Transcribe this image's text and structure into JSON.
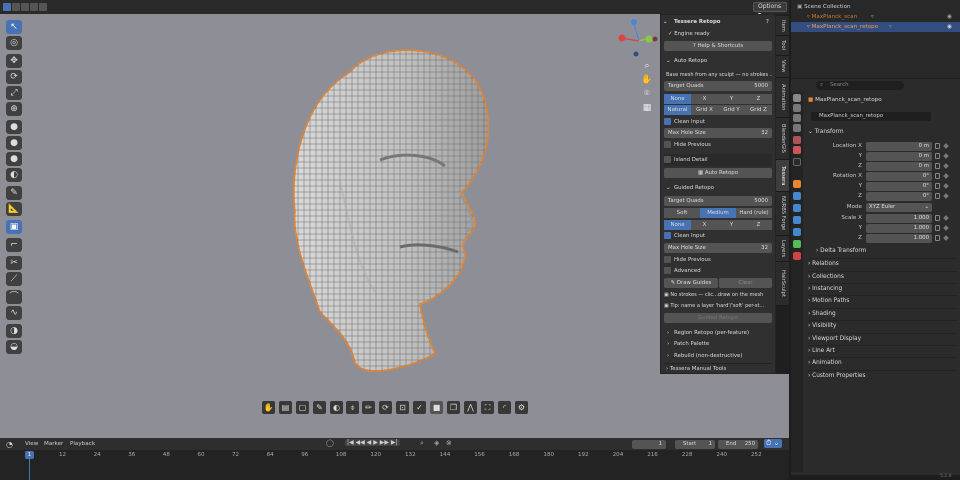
{
  "topbar": {
    "options_label": "Options"
  },
  "tessera": {
    "panel_title": "Tessera Retopo",
    "engine_status": "Engine ready",
    "help_label": "Help & Shortcuts",
    "auto": {
      "title": "Auto Retopo",
      "desc": "Base mesh from any sculpt — no strokes ...",
      "target_label": "Target Quads",
      "target_value": "5000",
      "sym": [
        "None",
        "X",
        "Y",
        "Z"
      ],
      "grid": [
        "Natural",
        "Grid X",
        "Grid Y",
        "Grid Z"
      ],
      "clean_input": "Clean Input",
      "max_hole_label": "Max Hole Size",
      "max_hole_value": "32",
      "hide_prev": "Hide Previous",
      "island": "Island Detail",
      "run": "Auto Retopo"
    },
    "guided": {
      "title": "Guided Retopo",
      "target_label": "Target Quads",
      "target_value": "5000",
      "density": [
        "Soft",
        "Medium",
        "Hard (rule)"
      ],
      "sym": [
        "None",
        "X",
        "Y",
        "Z"
      ],
      "clean_input": "Clean Input",
      "max_hole_label": "Max Hole Size",
      "max_hole_value": "32",
      "hide_prev": "Hide Previous",
      "advanced": "Advanced",
      "draw_guides": "Draw Guides",
      "clear": "Clear",
      "no_strokes": "No strokes — clic...draw on the mesh",
      "tip": "Tip: name a layer 'hard'/'soft' per-st...",
      "run": "Guided Retopo"
    },
    "subs": [
      "Region Retopo (per-feature)",
      "Patch Palette",
      "Rebuild (non-destructive)"
    ],
    "manual": "Tessera Manual Tools"
  },
  "ntabs": [
    "Item",
    "Tool",
    "View",
    "Animation",
    "BlenderGIS",
    "Tessera",
    "NURBS Forge",
    "Layers",
    "HairSculpt"
  ],
  "outliner": {
    "root": "Scene Collection",
    "items": [
      "MaxPlanck_scan",
      "MaxPlanck_scan_retopo"
    ]
  },
  "props": {
    "search_placeholder": "Search",
    "object_name": "MaxPlanck_scan_retopo",
    "object_name_field": "MaxPlanck_scan_retopo",
    "transform": "Transform",
    "location_label": "Location X",
    "y": "Y",
    "z": "Z",
    "location": [
      "0 m",
      "0 m",
      "0 m"
    ],
    "rotation_label": "Rotation X",
    "rotation": [
      "0°",
      "0°",
      "0°"
    ],
    "mode_label": "Mode",
    "mode": "XYZ Euler",
    "scale_label": "Scale X",
    "scale": [
      "1.000",
      "1.000",
      "1.000"
    ],
    "delta": "Delta Transform",
    "sections": [
      "Relations",
      "Collections",
      "Instancing",
      "Motion Paths",
      "Shading",
      "Visibility",
      "Viewport Display",
      "Line Art",
      "Animation",
      "Custom Properties"
    ]
  },
  "timeline": {
    "menus": [
      "View",
      "Marker",
      "Playback"
    ],
    "current_frame": "1",
    "start_label": "Start",
    "start": "1",
    "end_label": "End",
    "end": "250",
    "ticks": [
      "1",
      "12",
      "24",
      "36",
      "48",
      "60",
      "72",
      "84",
      "96",
      "108",
      "120",
      "132",
      "144",
      "156",
      "168",
      "180",
      "192",
      "204",
      "216",
      "228",
      "240",
      "252"
    ]
  },
  "version": "5.2.0",
  "colors": {
    "accent": "#4772b3",
    "selection": "#e8852f"
  }
}
